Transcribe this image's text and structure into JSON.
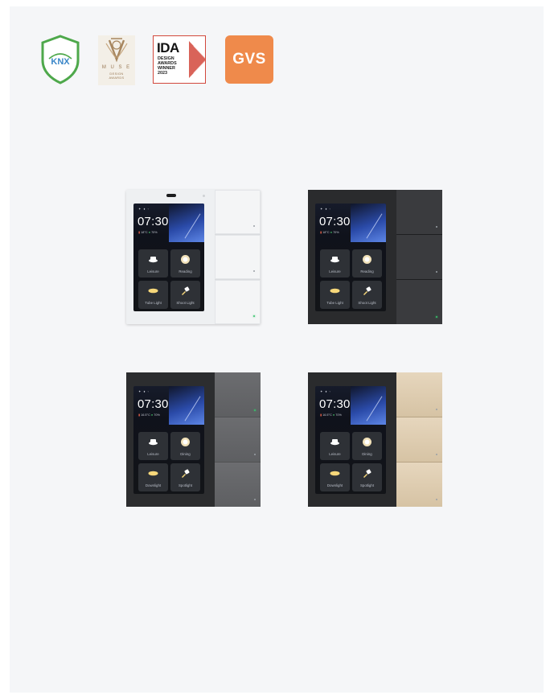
{
  "badges": [
    {
      "name": "knx",
      "text": "KNX",
      "color": "#4ea84b"
    },
    {
      "name": "muse",
      "title": "M U S E",
      "sub_1": "DESIGN",
      "sub_2": "AWARDS",
      "color": "#9a7a56"
    },
    {
      "name": "ida",
      "logo": "IDA",
      "line_1": "DESIGN",
      "line_2": "AWARDS",
      "line_3": "WINNER",
      "line_4": "2023",
      "color": "#d2483c"
    },
    {
      "name": "gvs",
      "text": "GVS",
      "color": "#ef8a4b"
    }
  ],
  "panels": [
    {
      "finish": "white",
      "time": "07:30",
      "status": "✦ ♦ ◦",
      "temp": "18°C",
      "humidity": "70%",
      "tiles": [
        "Leisure",
        "Reading",
        "Tube Light",
        "Shoot Light"
      ]
    },
    {
      "finish": "black",
      "time": "07:30",
      "status": "✦ ♦ ◦",
      "temp": "18°C",
      "humidity": "70%",
      "tiles": [
        "Leisure",
        "Reading",
        "Tube Light",
        "Shoot Light"
      ]
    },
    {
      "finish": "grey",
      "time": "07:30",
      "status": "✦ ♦ ◦",
      "temp": "16.5°C",
      "humidity": "70%",
      "tiles": [
        "Leisure",
        "Dining",
        "Downlight",
        "Spotlight"
      ]
    },
    {
      "finish": "gold",
      "time": "07:30",
      "status": "✦ ♦ ◦",
      "temp": "16.5°C",
      "humidity": "70%",
      "tiles": [
        "Leisure",
        "Dining",
        "Downlight",
        "Spotlight"
      ]
    }
  ],
  "icons": [
    "cup-icon",
    "lamp-icon",
    "tube-light-icon",
    "spot-light-icon"
  ]
}
